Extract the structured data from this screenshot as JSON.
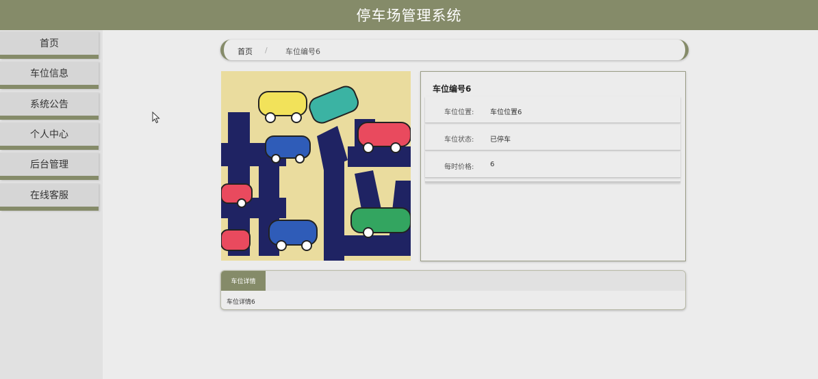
{
  "header": {
    "title": "停车场管理系统"
  },
  "sidebar": {
    "items": [
      {
        "label": "首页"
      },
      {
        "label": "车位信息"
      },
      {
        "label": "系统公告"
      },
      {
        "label": "个人中心"
      },
      {
        "label": "后台管理"
      },
      {
        "label": "在线客服"
      }
    ]
  },
  "breadcrumb": {
    "home": "首页",
    "separator": "/",
    "current": "车位编号6"
  },
  "product": {
    "image_text": "车位",
    "title": "车位编号6",
    "rows": [
      {
        "label": "车位位置:",
        "value": "车位位置6"
      },
      {
        "label": "车位状态:",
        "value": "已停车"
      },
      {
        "label": "每时价格:",
        "value": "6"
      }
    ]
  },
  "tabs": {
    "active_label": "车位详情",
    "content": "车位详情6"
  },
  "colors": {
    "accent": "#858b69",
    "background": "#ececec",
    "sidebar": "#e1e1e1"
  }
}
